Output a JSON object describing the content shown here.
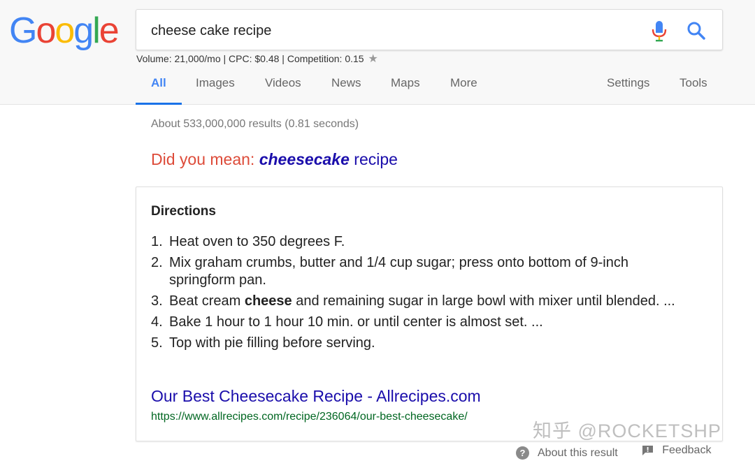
{
  "logo": {
    "letters": [
      "G",
      "o",
      "o",
      "g",
      "l",
      "e"
    ],
    "colors": [
      "#4285f4",
      "#ea4335",
      "#fbbc05",
      "#4285f4",
      "#34a853",
      "#ea4335"
    ]
  },
  "search": {
    "query": "cheese cake recipe",
    "mic_icon": "microphone-icon",
    "search_icon": "search-icon"
  },
  "seo_stats": {
    "text": "Volume: 21,000/mo | CPC: $0.48 | Competition: 0.15",
    "star_icon": "star-icon"
  },
  "tabs": {
    "all": "All",
    "images": "Images",
    "videos": "Videos",
    "news": "News",
    "maps": "Maps",
    "more": "More",
    "settings": "Settings",
    "tools": "Tools"
  },
  "results": {
    "stats": "About 533,000,000 results (0.81 seconds)",
    "did_you_mean_prefix": "Did you mean: ",
    "did_you_mean_bold": "cheesecake",
    "did_you_mean_rest": " recipe"
  },
  "snippet": {
    "title": "Directions",
    "steps": [
      {
        "num": "1.",
        "text": "Heat oven to 350 degrees F."
      },
      {
        "num": "2.",
        "text": "Mix graham crumbs, butter and 1/4 cup sugar; press onto bottom of 9-inch springform pan."
      },
      {
        "num": "3.",
        "pre": "Beat cream ",
        "bold": "cheese",
        "post": " and remaining sugar in large bowl with mixer until blended. ..."
      },
      {
        "num": "4.",
        "text": "Bake 1 hour to 1 hour 10 min. or until center is almost set. ..."
      },
      {
        "num": "5.",
        "text": "Top with pie filling before serving."
      }
    ],
    "link_title": "Our Best Cheesecake Recipe - Allrecipes.com",
    "link_url": "https://www.allrecipes.com/recipe/236064/our-best-cheesecake/"
  },
  "footer": {
    "about": "About this result",
    "feedback": "Feedback",
    "help_icon": "?"
  },
  "watermark": "知乎 @ROCKETSHP",
  "colors": {
    "link": "#1a0dab",
    "url_green": "#006621",
    "did_you_mean_red": "#dd4b39",
    "active_tab": "#1a73e8"
  }
}
